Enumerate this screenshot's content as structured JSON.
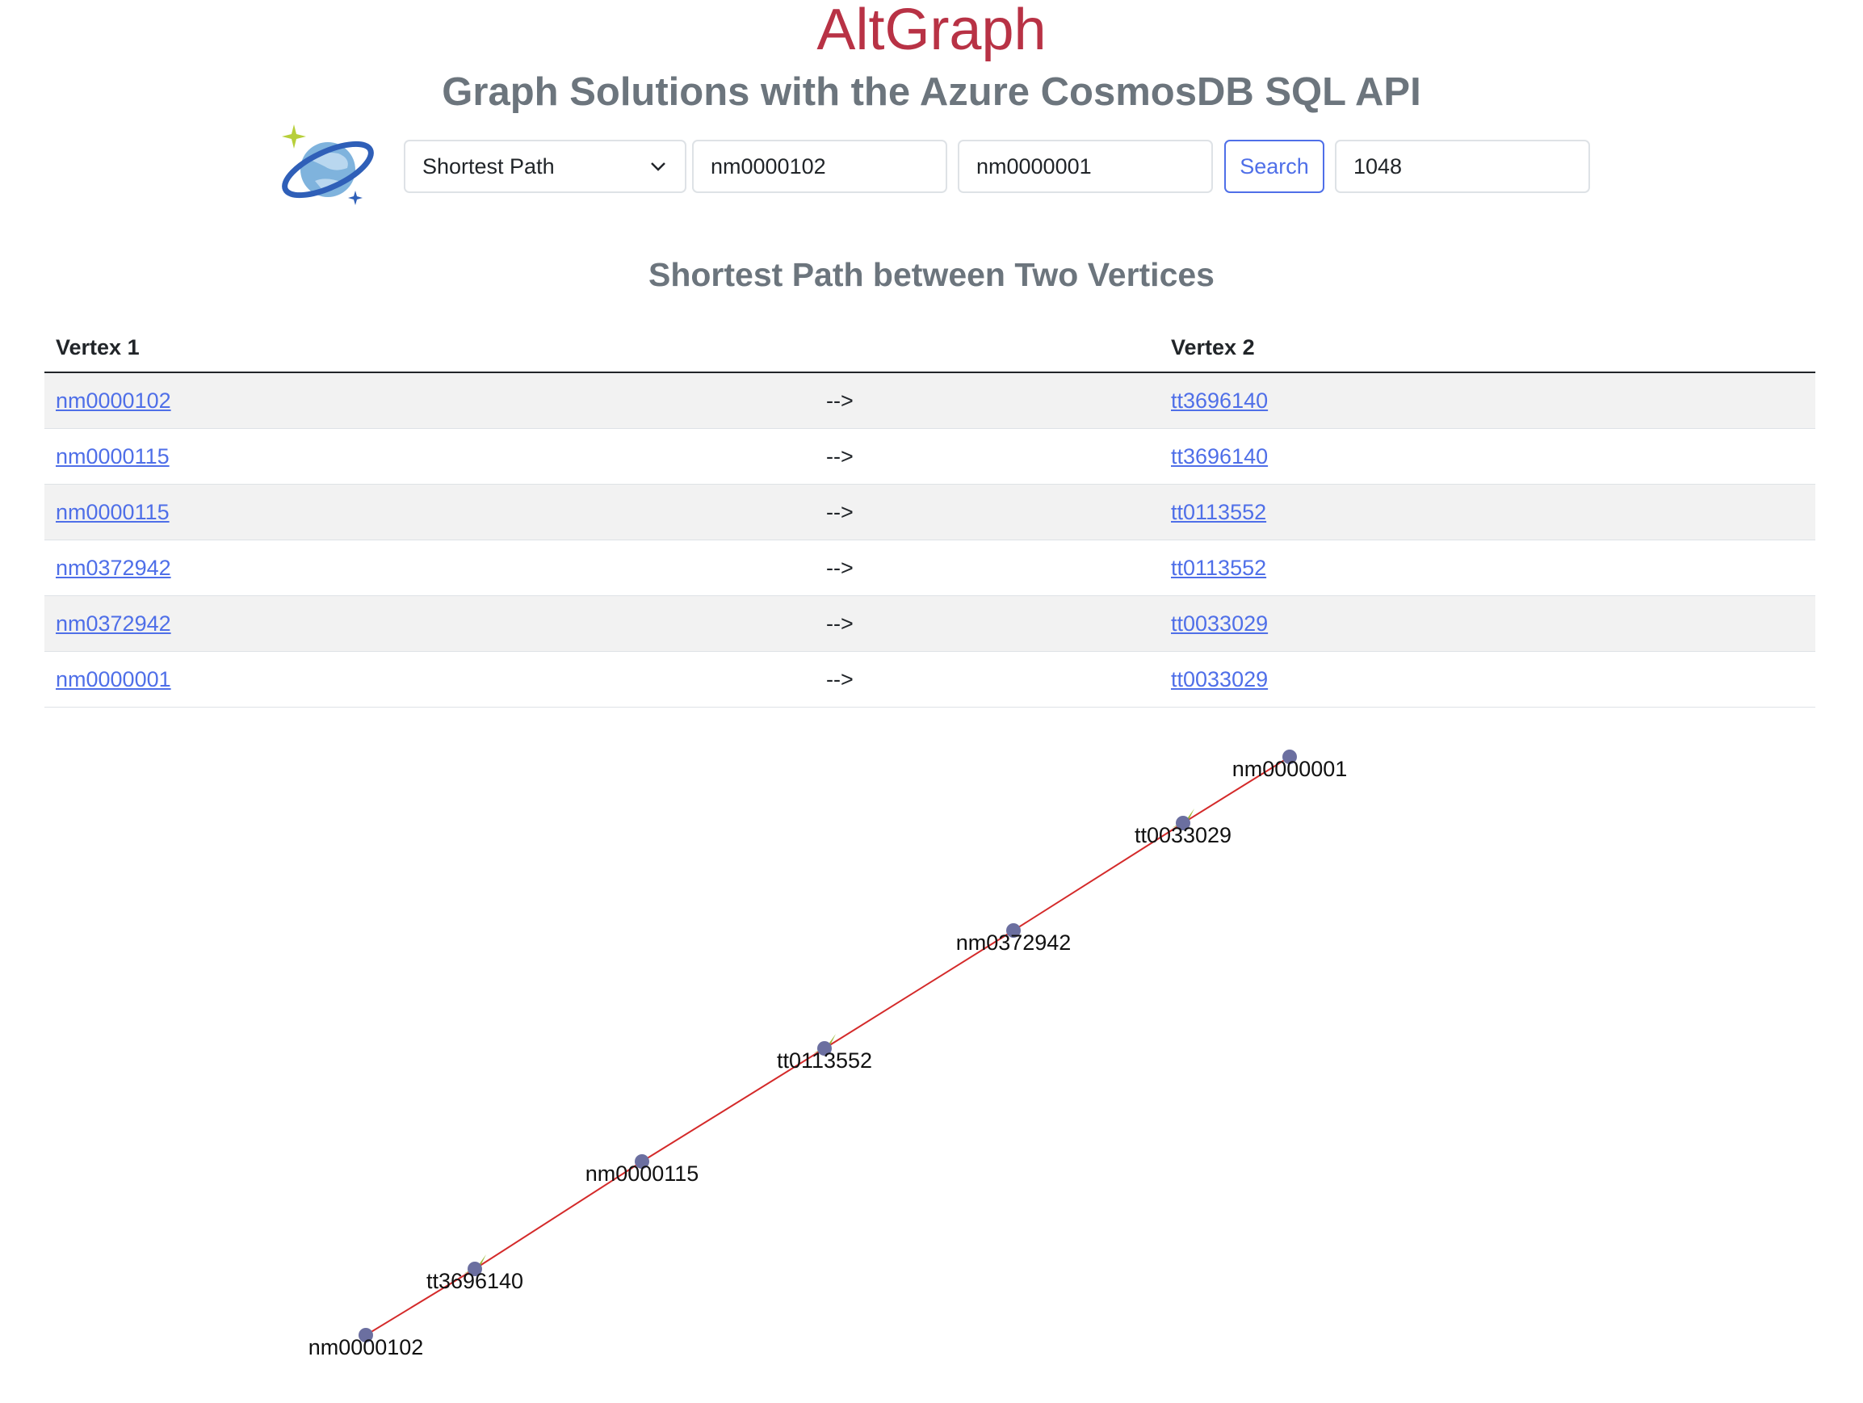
{
  "header": {
    "title": "AltGraph",
    "subtitle": "Graph Solutions with the Azure CosmosDB SQL API"
  },
  "controls": {
    "query_type": "Shortest Path",
    "vertex1_value": "nm0000102",
    "vertex2_value": "nm0000001",
    "search_label": "Search",
    "result_value": "1048"
  },
  "section": {
    "title": "Shortest Path between Two Vertices"
  },
  "table": {
    "headers": [
      "Vertex 1",
      "",
      "Vertex 2"
    ],
    "rows": [
      {
        "v1": "nm0000102",
        "arrow": "-->",
        "v2": "tt3696140"
      },
      {
        "v1": "nm0000115",
        "arrow": "-->",
        "v2": "tt3696140"
      },
      {
        "v1": "nm0000115",
        "arrow": "-->",
        "v2": "tt0113552"
      },
      {
        "v1": "nm0372942",
        "arrow": "-->",
        "v2": "tt0113552"
      },
      {
        "v1": "nm0372942",
        "arrow": "-->",
        "v2": "tt0033029"
      },
      {
        "v1": "nm0000001",
        "arrow": "-->",
        "v2": "tt0033029"
      }
    ]
  },
  "graph": {
    "nodes": [
      "nm0000102",
      "tt3696140",
      "nm0000115",
      "tt0113552",
      "nm0372942",
      "tt0033029",
      "nm0000001"
    ],
    "colors": {
      "node": "#6b6fa0",
      "edge": "#d42a2a",
      "arrow": "#9bb836"
    }
  },
  "colors": {
    "brand": "#b83245",
    "link": "#4f6fe8",
    "muted": "#6c757d"
  }
}
